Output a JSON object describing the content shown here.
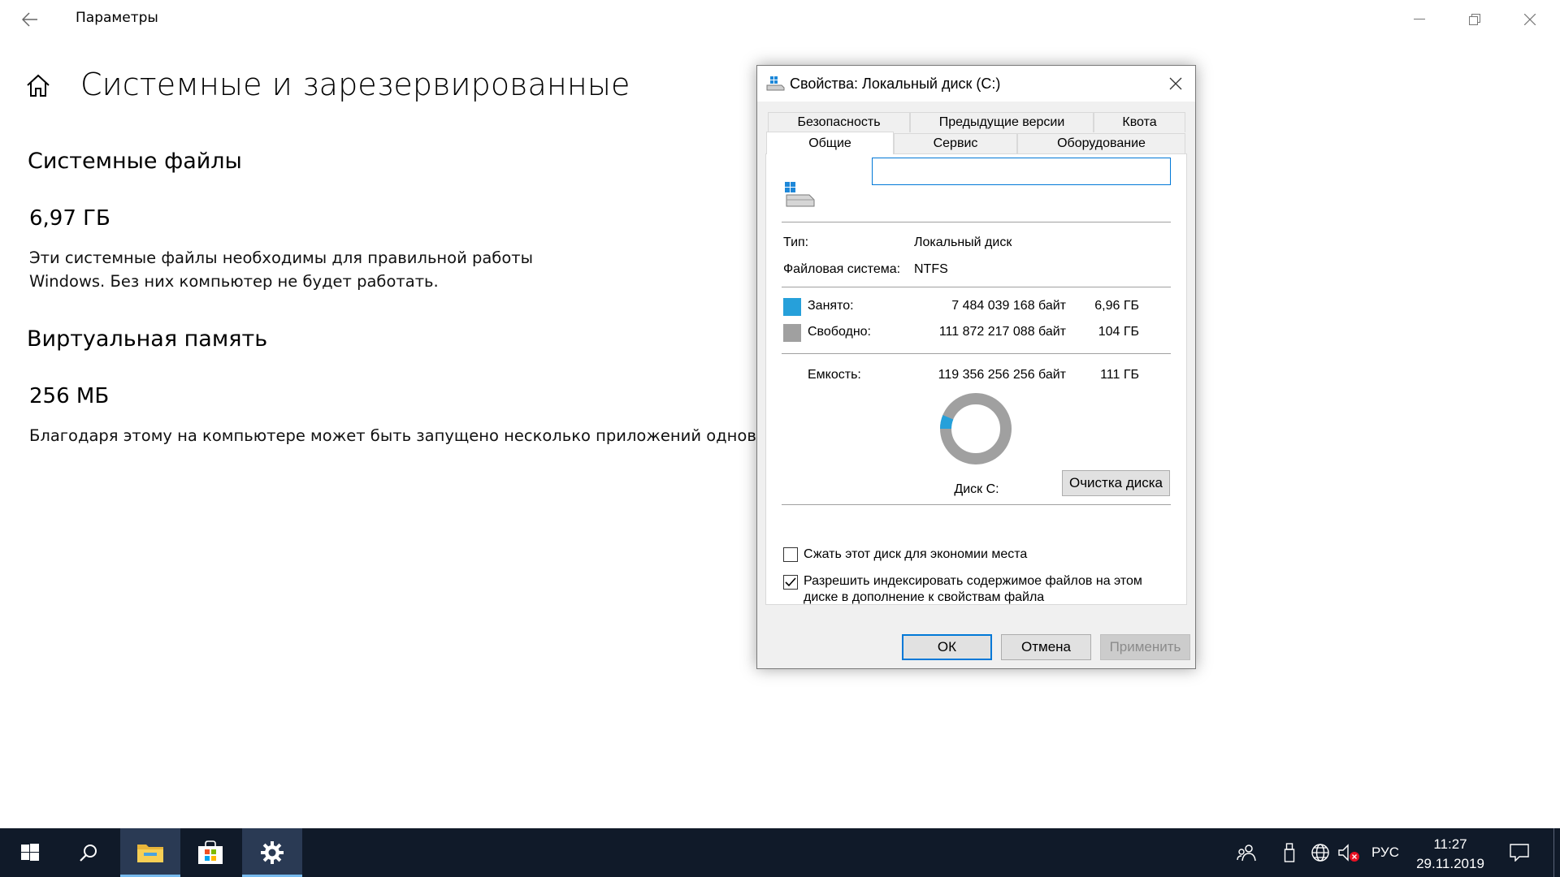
{
  "window": {
    "title": "Параметры",
    "icons": [
      "back-arrow-icon",
      "minimize-icon",
      "restore-icon",
      "close-icon",
      "home-icon"
    ]
  },
  "page": {
    "title": "Системные и зарезервированные",
    "sections": [
      {
        "heading": "Системные файлы",
        "size": "6,97 ГБ",
        "description_line1": "Эти системные файлы необходимы для правильной работы",
        "description_line2": "Windows. Без них компьютер не будет работать."
      },
      {
        "heading": "Виртуальная память",
        "size": "256 МБ",
        "description_line1": "Благодаря этому на компьютере может быть запущено несколько приложений одновремен"
      }
    ]
  },
  "dialog": {
    "title": "Свойства: Локальный диск (C:)",
    "tabs_row1": [
      "Безопасность",
      "Предыдущие версии",
      "Квота"
    ],
    "tabs_row2": [
      "Общие",
      "Сервис",
      "Оборудование"
    ],
    "active_tab": "Общие",
    "name_value": "",
    "type_label": "Тип:",
    "type_value": "Локальный диск",
    "fs_label": "Файловая система:",
    "fs_value": "NTFS",
    "used": {
      "label": "Занято:",
      "bytes": "7 484 039 168 байт",
      "size": "6,96 ГБ",
      "color": "#26a0da"
    },
    "free": {
      "label": "Свободно:",
      "bytes": "111 872 217 088 байт",
      "size": "104 ГБ",
      "color": "#a0a0a0"
    },
    "capacity": {
      "label": "Емкость:",
      "bytes": "119 356 256 256 байт",
      "size": "111 ГБ"
    },
    "used_fraction": 0.0627,
    "drive_label": "Диск C:",
    "cleanup_button": "Очистка диска",
    "compress_checkbox": {
      "label": "Сжать этот диск для экономии места",
      "checked": false
    },
    "index_checkbox": {
      "label_line1": "Разрешить индексировать содержимое файлов на этом",
      "label_line2": "диске в дополнение к свойствам файла",
      "checked": true
    },
    "buttons": {
      "ok": "ОК",
      "cancel": "Отмена",
      "apply": "Применить"
    }
  },
  "taskbar": {
    "items": [
      "start-icon",
      "search-icon",
      "file-explorer-icon",
      "store-icon",
      "settings-icon"
    ],
    "active": [
      "file-explorer-icon",
      "settings-icon"
    ],
    "language": "РУС",
    "time": "11:27",
    "date": "29.11.2019"
  }
}
